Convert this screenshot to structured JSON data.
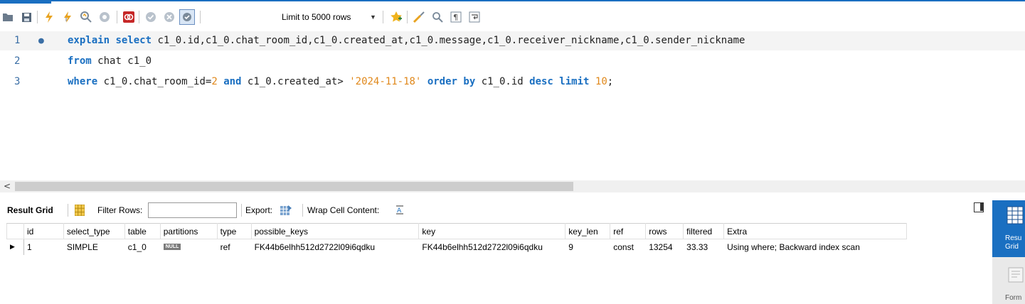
{
  "toolbar": {
    "limit_label": "Limit to 5000 rows",
    "icons": [
      "open-folder-icon",
      "save-icon",
      "execute-icon",
      "execute-current-icon",
      "explain-icon",
      "stop-icon",
      "toggle-continue-on-error-icon",
      "commit-icon",
      "rollback-icon",
      "autocommit-icon",
      "beautify-icon",
      "find-icon",
      "invisible-chars-icon",
      "wrap-icon",
      "add-snippet-icon"
    ]
  },
  "editor": {
    "lines": [
      {
        "num": "1",
        "marker": "●"
      },
      {
        "num": "2"
      },
      {
        "num": "3"
      }
    ],
    "line1": {
      "kw1": "explain",
      "kw2": "select",
      "rest": "c1_0.id,c1_0.chat_room_id,c1_0.created_at,c1_0.message,c1_0.receiver_nickname,c1_0.sender_nickname"
    },
    "line2": {
      "kw1": "from",
      "rest": "chat c1_0"
    },
    "line3": {
      "kw1": "where",
      "t1": "c1_0.chat_room_id=",
      "n1": "2",
      "kw2": "and",
      "t2": "c1_0.created_at>",
      "s1": "'2024-11-18'",
      "kw3": "order by",
      "t3": "c1_0.id",
      "kw4": "desc",
      "kw5": "limit",
      "n2": "10",
      "t4": ";"
    }
  },
  "resultbar": {
    "result_grid": "Result Grid",
    "filter_rows": "Filter Rows:",
    "filter_value": "",
    "export": "Export:",
    "wrap": "Wrap Cell Content:"
  },
  "grid": {
    "columns": [
      "id",
      "select_type",
      "table",
      "partitions",
      "type",
      "possible_keys",
      "key",
      "key_len",
      "ref",
      "rows",
      "filtered",
      "Extra"
    ],
    "rows": [
      [
        "1",
        "SIMPLE",
        "c1_0",
        "NULL",
        "ref",
        "FK44b6elhh512d2722l09i6qdku",
        "FK44b6elhh512d2722l09i6qdku",
        "9",
        "const",
        "13254",
        "33.33",
        "Using where; Backward index scan"
      ]
    ]
  },
  "rightpanel": {
    "result_label_1": "Resu",
    "result_label_2": "Grid",
    "form_label": "Form"
  },
  "colors": {
    "keyword": "#1a6fc1",
    "literal": "#e0881b",
    "accent": "#1a6fc1"
  }
}
